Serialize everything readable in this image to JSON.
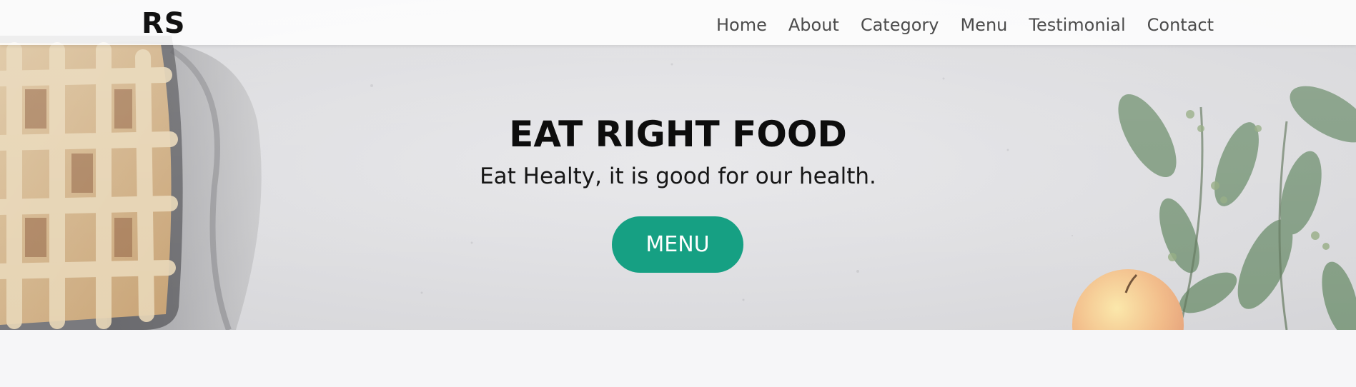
{
  "brand": {
    "logo_text": "RS"
  },
  "nav": {
    "links": [
      {
        "label": "Home"
      },
      {
        "label": "About"
      },
      {
        "label": "Category"
      },
      {
        "label": "Menu"
      },
      {
        "label": "Testimonial"
      },
      {
        "label": "Contact"
      }
    ]
  },
  "hero": {
    "title": "EAT RIGHT FOOD",
    "subtitle": "Eat Healty, it is good for our health.",
    "button_label": "MENU",
    "images": [
      "lattice-pie-image",
      "apple-and-leaves-image"
    ]
  },
  "colors": {
    "accent": "#16a083",
    "background": "#f6f6f8",
    "hero_bg": "#d9d9dc",
    "nav_text": "#4c4c4c"
  }
}
